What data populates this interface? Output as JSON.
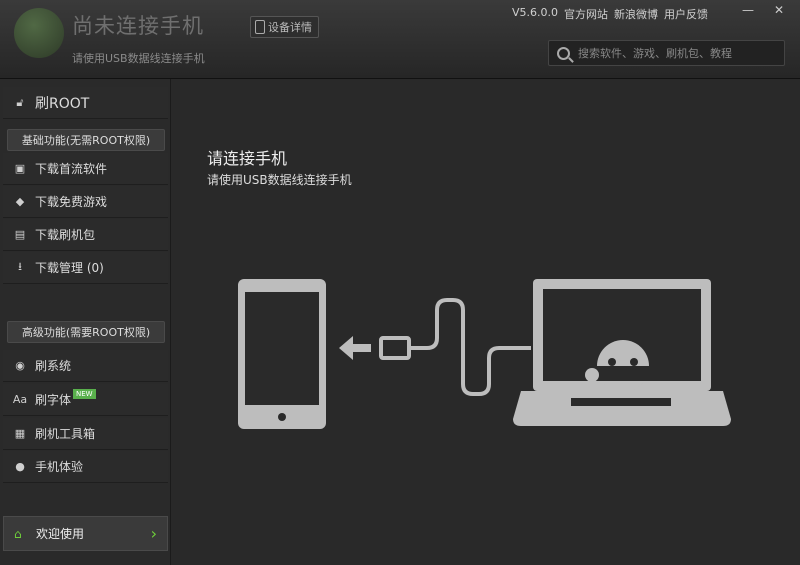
{
  "header": {
    "title": "尚未连接手机",
    "subtitle": "请使用USB数据线连接手机",
    "device_button": "设备详情",
    "version": "V5.6.0.0",
    "links": [
      "官方网站",
      "新浪微博",
      "用户反馈"
    ],
    "search_placeholder": "搜索软件、游戏、刷机包、教程"
  },
  "sidebar": {
    "root": "刷ROOT",
    "section_basic": "基础功能(无需ROOT权限)",
    "basic_items": [
      "下载首流软件",
      "下载免费游戏",
      "下载刷机包",
      "下载管理 (0)"
    ],
    "section_advanced": "高级功能(需要ROOT权限)",
    "advanced_items": [
      "刷系统",
      "刷字体",
      "刷机工具箱",
      "手机体验"
    ],
    "new_badge": "NEW",
    "welcome": "欢迎使用"
  },
  "main": {
    "heading": "请连接手机",
    "hint": "请使用USB数据线连接手机"
  },
  "colors": {
    "accent": "#59b04c",
    "arrow": "#6fcf3a"
  }
}
